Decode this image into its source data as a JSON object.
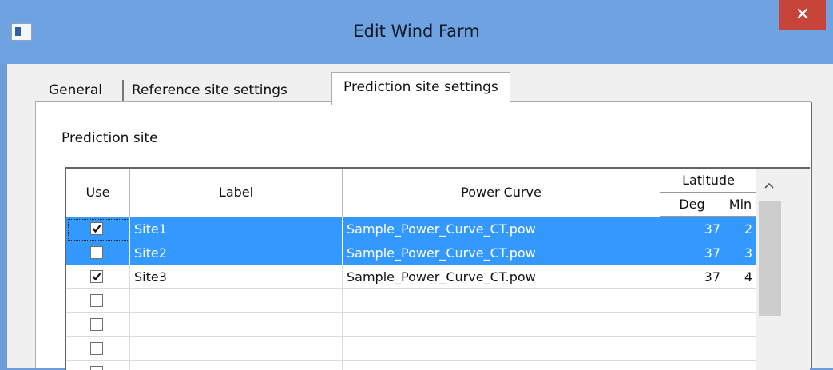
{
  "window": {
    "title": "Edit Wind Farm",
    "close_glyph": "✕"
  },
  "tabs": [
    {
      "label": "General"
    },
    {
      "label": "Reference site settings"
    },
    {
      "label": "Prediction site settings"
    }
  ],
  "section": {
    "label": "Prediction site"
  },
  "grid": {
    "columns": {
      "use": "Use",
      "label": "Label",
      "power_curve": "Power Curve",
      "latitude": "Latitude",
      "deg": "Deg",
      "min": "Min"
    },
    "rows": [
      {
        "use": true,
        "label": "Site1",
        "power_curve": "Sample_Power_Curve_CT.pow",
        "deg": "37",
        "min": "2",
        "selected": true
      },
      {
        "use": false,
        "label": "Site2",
        "power_curve": "Sample_Power_Curve_CT.pow",
        "deg": "37",
        "min": "3",
        "selected": true
      },
      {
        "use": true,
        "label": "Site3",
        "power_curve": "Sample_Power_Curve_CT.pow",
        "deg": "37",
        "min": "4",
        "selected": false
      },
      {
        "use": false,
        "label": "",
        "power_curve": "",
        "deg": "",
        "min": "",
        "selected": false
      },
      {
        "use": false,
        "label": "",
        "power_curve": "",
        "deg": "",
        "min": "",
        "selected": false
      },
      {
        "use": false,
        "label": "",
        "power_curve": "",
        "deg": "",
        "min": "",
        "selected": false
      },
      {
        "use": false,
        "label": "",
        "power_curve": "",
        "deg": "",
        "min": "",
        "selected": false
      }
    ]
  },
  "icons": {
    "app": "window-app-icon",
    "close": "close-icon",
    "scroll_up": "chevron-up-icon",
    "check": "checkmark-icon"
  },
  "colors": {
    "titlebar": "#6fa2e0",
    "close": "#c7443a",
    "selection": "#3399ff"
  }
}
